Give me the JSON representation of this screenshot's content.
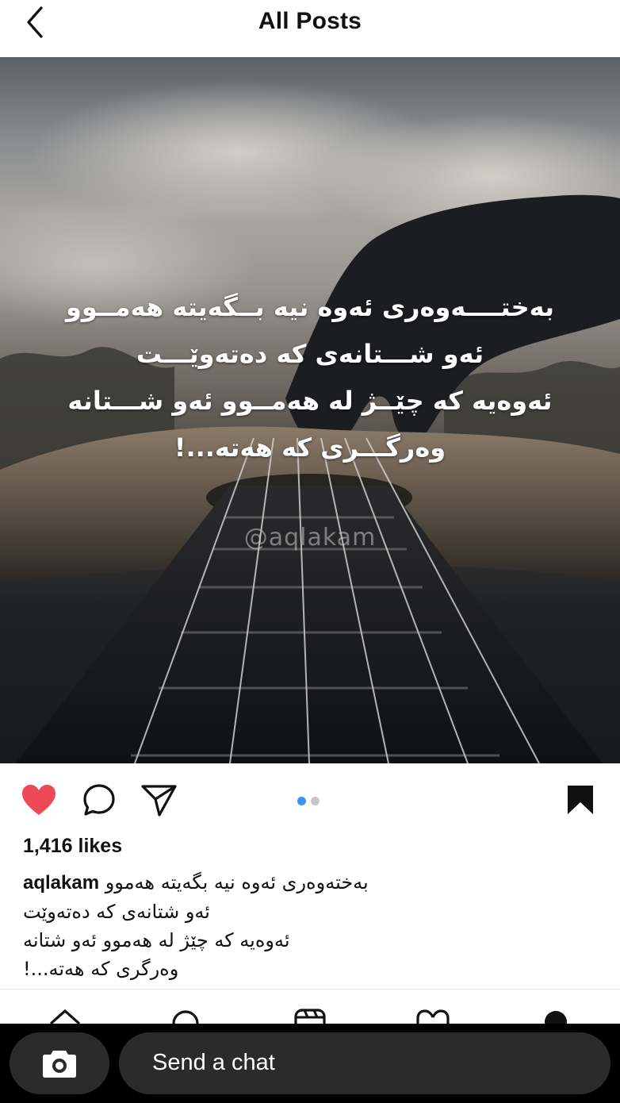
{
  "header": {
    "title": "All Posts",
    "back_icon": "chevron-left-icon"
  },
  "post": {
    "image_overlay_lines": [
      "بەختــــەوەری ئەوە نیە بــگەیتە هەمــوو",
      "ئەو شـــتانەی کە دەتەوێـــت",
      "ئەوەیە کە چێــژ لە هەمــوو ئەو شـــتانە",
      "وەرگـــری کە هەتە...!"
    ],
    "watermark": "@aqlakam",
    "likes_text": "1,416 likes",
    "caption_username": "aqlakam",
    "caption_lines": [
      "بەختەوەری ئەوە نیە بگەیتە هەموو",
      "ئەو شتانەی کە دەتەوێت",
      "ئەوەیە کە چێژ لە هەموو ئەو شتانە",
      "وەرگری کە هەتە...!"
    ],
    "carousel": {
      "count": 2,
      "active_index": 0
    },
    "liked": true,
    "saved": true
  },
  "colors": {
    "like_red": "#ED4956",
    "carousel_active": "#3897F0",
    "carousel_inactive": "#C7C7C7",
    "snap_bar": "#000000",
    "snap_pill": "#2B2B2B"
  },
  "snap": {
    "camera_icon": "camera-icon",
    "chat_placeholder": "Send a chat"
  }
}
